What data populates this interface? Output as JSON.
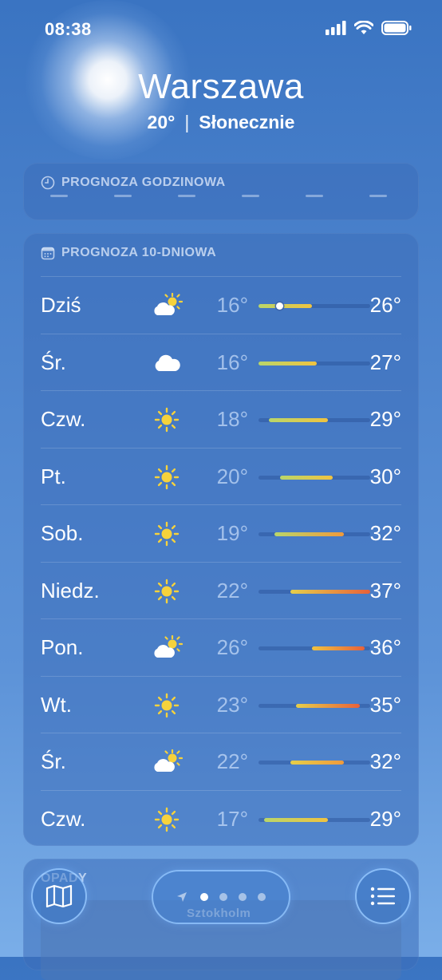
{
  "status_bar": {
    "time": "08:38"
  },
  "header": {
    "city": "Warszawa",
    "temperature": "20°",
    "separator": "|",
    "condition": "Słonecznie"
  },
  "hourly": {
    "title": "PROGNOZA GODZINOWA"
  },
  "daily": {
    "title": "PROGNOZA 10-DNIOWA",
    "days": [
      {
        "day": "Dziś",
        "icon": "partly-cloudy-sun-icon",
        "low": "16°",
        "high": "26°",
        "low_value": 16,
        "high_value": 26,
        "current_value": 20
      },
      {
        "day": "Śr.",
        "icon": "cloud-icon",
        "low": "16°",
        "high": "27°",
        "low_value": 16,
        "high_value": 27
      },
      {
        "day": "Czw.",
        "icon": "sun-icon",
        "low": "18°",
        "high": "29°",
        "low_value": 18,
        "high_value": 29
      },
      {
        "day": "Pt.",
        "icon": "sun-icon",
        "low": "20°",
        "high": "30°",
        "low_value": 20,
        "high_value": 30
      },
      {
        "day": "Sob.",
        "icon": "sun-icon",
        "low": "19°",
        "high": "32°",
        "low_value": 19,
        "high_value": 32
      },
      {
        "day": "Niedz.",
        "icon": "sun-icon",
        "low": "22°",
        "high": "37°",
        "low_value": 22,
        "high_value": 37
      },
      {
        "day": "Pon.",
        "icon": "partly-cloudy-sun-icon",
        "low": "26°",
        "high": "36°",
        "low_value": 26,
        "high_value": 36
      },
      {
        "day": "Wt.",
        "icon": "sun-icon",
        "low": "23°",
        "high": "35°",
        "low_value": 23,
        "high_value": 35
      },
      {
        "day": "Śr.",
        "icon": "partly-cloudy-sun-icon",
        "low": "22°",
        "high": "32°",
        "low_value": 22,
        "high_value": 32
      },
      {
        "day": "Czw.",
        "icon": "sun-icon",
        "low": "17°",
        "high": "29°",
        "low_value": 17,
        "high_value": 29
      }
    ],
    "range_min": 16,
    "range_max": 37
  },
  "precipitation": {
    "title": "OPADY"
  },
  "bottom_bar": {
    "map_icon": "map-icon",
    "list_icon": "list-icon",
    "location_icon": "location-arrow-icon",
    "page_count": 4,
    "active_page": 1
  },
  "watermark": "Sztokholm",
  "colors": {
    "accent_cold": "#b9d66a",
    "accent_warm": "#f0c340",
    "accent_hot": "#e8613a"
  }
}
